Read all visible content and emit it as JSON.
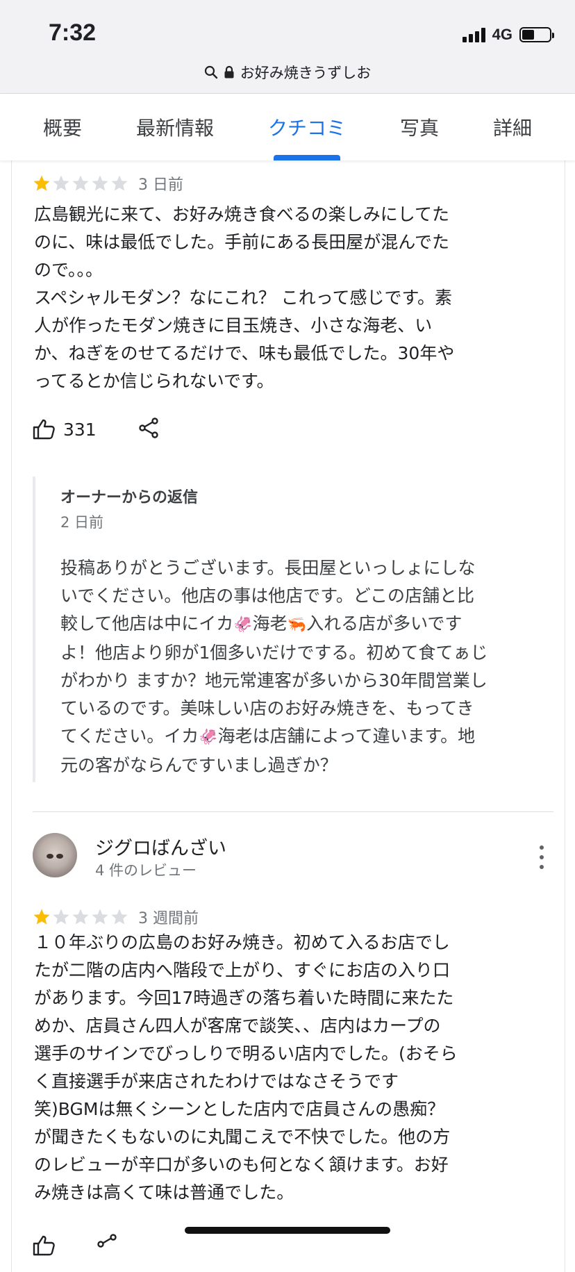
{
  "status_bar": {
    "time": "7:32",
    "network": "4G"
  },
  "url_bar": {
    "title": "お好み焼きうずしお",
    "search_icon": "search-icon",
    "lock_icon": "lock-icon"
  },
  "tabs": [
    {
      "label": "概要",
      "active": false
    },
    {
      "label": "最新情報",
      "active": false
    },
    {
      "label": "クチコミ",
      "active": true
    },
    {
      "label": "写真",
      "active": false
    },
    {
      "label": "詳細",
      "active": false
    }
  ],
  "colors": {
    "accent": "#1a73e8",
    "star_filled": "#fbbc04",
    "star_empty": "#dadce0"
  },
  "review1": {
    "rating": 1,
    "max_rating": 5,
    "ago": "3 日前",
    "lines": [
      "広島観光に来て、お好み焼き食べるの楽しみにしてた",
      "のに、味は最低でした。手前にある長田屋が混んでた",
      "ので。。。",
      "スペシャルモダン？なにこれ？ これって感じです。素",
      "人が作ったモダン焼きに目玉焼き、小さな海老、い",
      "か、ねぎをのせてるだけで、味も最低でした。30年や",
      "ってるとか信じられないです。"
    ],
    "likes": "331",
    "owner_reply": {
      "title": "オーナーからの返信",
      "ago": "2 日前",
      "lines": [
        [
          "投稿ありがとうございます。長田屋といっしょにしな"
        ],
        [
          "いでください。他店の事は他店です。どこの店舗と比"
        ],
        [
          "較して他店は中にイカ",
          "🦑",
          "海老",
          "🦐",
          "入れる店が多いです"
        ],
        [
          "よ！他店より卵が1個多いだけでする。初めて食てぁじ"
        ],
        [
          "がわかり ますか？地元常連客が多いから30年間営業し"
        ],
        [
          "ているのです。美味しい店のお好み焼きを、もってき"
        ],
        [
          "てください。イカ",
          "🦑",
          "海老は店舗によって違います。地"
        ],
        [
          "元の客がならんですいまし過ぎか？"
        ]
      ]
    }
  },
  "review2": {
    "reviewer_name": "ジグロばんざい",
    "reviewer_meta": "4 件のレビュー",
    "rating": 1,
    "max_rating": 5,
    "ago": "3 週間前",
    "lines": [
      "１０年ぶりの広島のお好み焼き。初めて入るお店でし",
      "たが二階の店内へ階段で上がり、すぐにお店の入り口",
      "があります。今回17時過ぎの落ち着いた時間に来たた",
      "めか、店員さん四人が客席で談笑、、店内はカープの",
      "選手のサインでびっしりで明るい店内でした。(おそら",
      "く直接選手が来店されたわけではなさそうです",
      "笑)BGMは無くシーンとした店内で店員さんの愚痴？",
      "が聞きたくもないのに丸聞こえで不快でした。他の方",
      "のレビューが辛口が多いのも何となく頷けます。お好",
      "み焼きは高くて味は普通でした。"
    ]
  }
}
